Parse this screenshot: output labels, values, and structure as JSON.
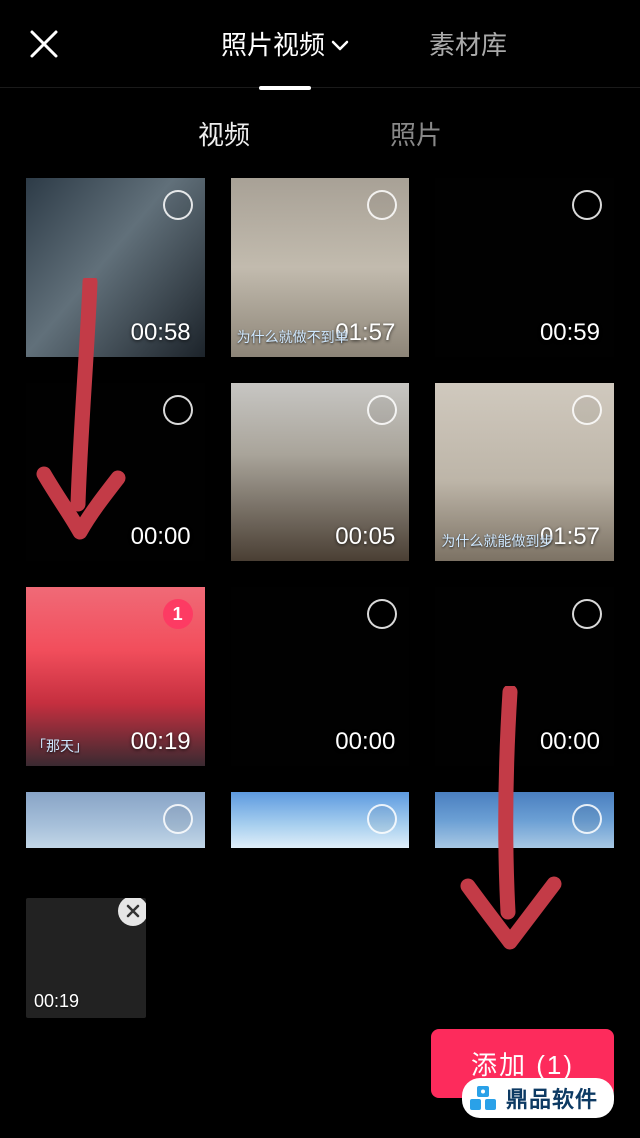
{
  "header": {
    "tabs": [
      {
        "label": "照片视频",
        "active": true,
        "hasDropdown": true
      },
      {
        "label": "素材库",
        "active": false,
        "hasDropdown": false
      }
    ]
  },
  "subTabs": [
    {
      "label": "视频",
      "active": true
    },
    {
      "label": "照片",
      "active": false
    }
  ],
  "videos": [
    {
      "duration": "00:58",
      "caption": "",
      "selected": false,
      "thumb": "th-0"
    },
    {
      "duration": "01:57",
      "caption": "为什么就做不到单",
      "selected": false,
      "thumb": "th-1"
    },
    {
      "duration": "00:59",
      "caption": "",
      "selected": false,
      "thumb": "th-2"
    },
    {
      "duration": "00:00",
      "caption": "",
      "selected": false,
      "thumb": "th-3"
    },
    {
      "duration": "00:05",
      "caption": "",
      "selected": false,
      "thumb": "th-4"
    },
    {
      "duration": "01:57",
      "caption": "为什么就能做到步",
      "selected": false,
      "thumb": "th-5"
    },
    {
      "duration": "00:19",
      "caption": "「那天」",
      "selected": true,
      "selectIndex": "1",
      "thumb": "th-6"
    },
    {
      "duration": "00:00",
      "caption": "",
      "selected": false,
      "thumb": "th-7"
    },
    {
      "duration": "00:00",
      "caption": "",
      "selected": false,
      "thumb": "th-8"
    },
    {
      "duration": "",
      "caption": "",
      "selected": false,
      "thumb": "th-9",
      "short": true
    },
    {
      "duration": "",
      "caption": "",
      "selected": false,
      "thumb": "th-10",
      "short": true
    },
    {
      "duration": "",
      "caption": "",
      "selected": false,
      "thumb": "th-11",
      "short": true
    }
  ],
  "tray": [
    {
      "duration": "00:19",
      "thumb": "th-6"
    }
  ],
  "footer": {
    "addLabel": "添加 (1)"
  },
  "watermark": {
    "text": "鼎品软件"
  }
}
